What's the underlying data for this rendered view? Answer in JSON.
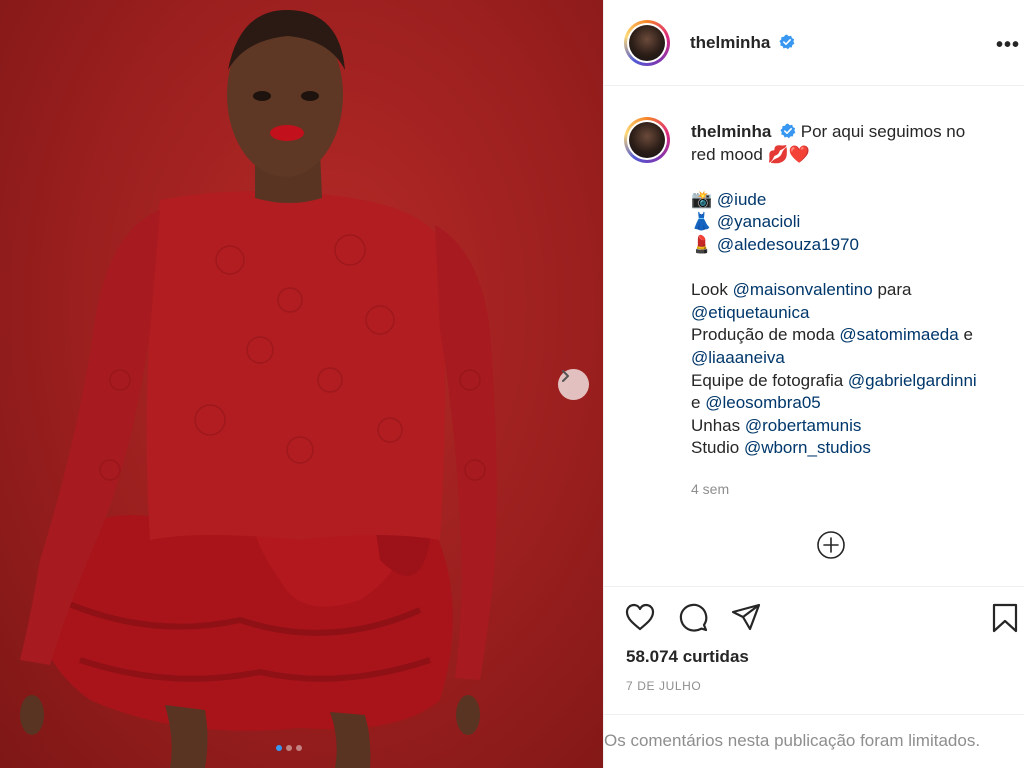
{
  "post": {
    "username": "thelminha",
    "more_label": "•••",
    "caption": {
      "username": "thelminha",
      "text_line1": "Por aqui seguimos no",
      "text_line2": "red mood",
      "line2_emoji": "💋❤️",
      "credits": [
        {
          "emoji": "📸",
          "mention": "@iude"
        },
        {
          "emoji": "👗",
          "mention": "@yanacioli"
        },
        {
          "emoji": "💄",
          "mention": "@aledesouza1970"
        }
      ],
      "look_prefix": "Look",
      "look_mention": "@maisonvalentino",
      "look_suffix": "para",
      "look_mention2": "@etiquetaunica",
      "prod_prefix": "Produção de moda",
      "prod_mention": "@satomimaeda",
      "prod_suffix": "e",
      "prod_mention2": "@liaaaneiva",
      "equipe_prefix": "Equipe de fotografia",
      "equipe_mention": "@gabrielgardinni",
      "equipe_joiner": "e",
      "equipe_mention2": "@leosombra05",
      "unhas_prefix": "Unhas",
      "unhas_mention": "@robertamunis",
      "studio_prefix": "Studio",
      "studio_mention": "@wborn_studios"
    },
    "time_ago": "4 sem",
    "likes": "58.074 curtidas",
    "date": "7 DE JULHO",
    "comments_note": "Os comentários nesta publicação foram limitados."
  },
  "carousel": {
    "count": 3,
    "active_index": 0
  },
  "colors": {
    "photo_bg": "#9a1f1e",
    "mention": "#00376b",
    "verified": "#3897f0",
    "muted": "#8e8e8e"
  },
  "icons": [
    "verified-badge-icon",
    "more-options-icon",
    "add-comment-icon",
    "heart-icon",
    "comment-icon",
    "share-icon",
    "bookmark-icon",
    "chevron-right-icon"
  ]
}
